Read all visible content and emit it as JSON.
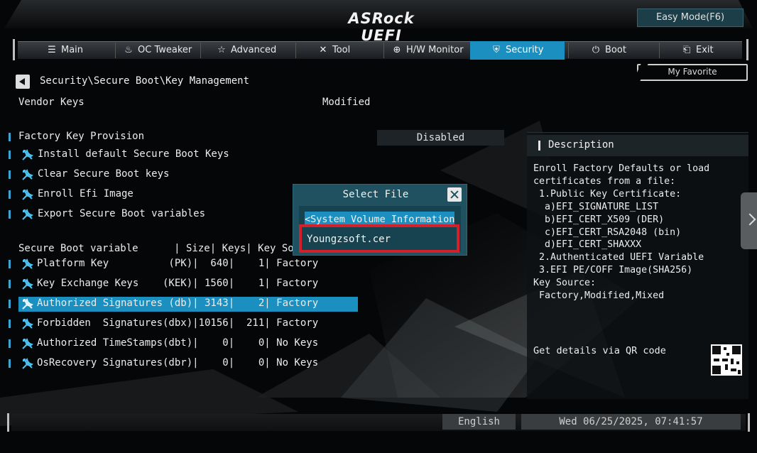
{
  "header": {
    "logo": "ASRock UEFI",
    "easy_mode": "Easy Mode(F6)",
    "my_favorite": "My Favorite"
  },
  "nav": {
    "tabs": [
      {
        "label": "Main",
        "icon": "list-icon"
      },
      {
        "label": "OC Tweaker",
        "icon": "flame-icon"
      },
      {
        "label": "Advanced",
        "icon": "star-icon"
      },
      {
        "label": "Tool",
        "icon": "tools-icon"
      },
      {
        "label": "H/W Monitor",
        "icon": "monitor-icon"
      },
      {
        "label": "Security",
        "icon": "shield-icon"
      },
      {
        "label": "Boot",
        "icon": "power-icon"
      },
      {
        "label": "Exit",
        "icon": "exit-icon"
      }
    ],
    "active": "Security"
  },
  "breadcrumb": "Security\\Secure Boot\\Key Management",
  "vendor_keys": {
    "label": "Vendor Keys",
    "value": "Modified"
  },
  "factory_key_provision": {
    "label": "Factory Key Provision",
    "value": "Disabled"
  },
  "actions": [
    "Install default Secure Boot Keys",
    "Clear Secure Boot keys",
    "Enroll Efi Image",
    "Export Secure Boot variables"
  ],
  "table": {
    "header": "Secure Boot variable      | Size| Keys| Key Source",
    "rows": [
      {
        "text": "Platform Key          (PK)|  640|    1| Factory"
      },
      {
        "text": "Key Exchange Keys    (KEK)| 1560|    1| Factory"
      },
      {
        "text": "Authorized Signatures (db)| 3143|    2| Factory"
      },
      {
        "text": "Forbidden  Signatures(dbx)|10156|  211| Factory"
      },
      {
        "text": "Authorized TimeStamps(dbt)|    0|    0| No Keys"
      },
      {
        "text": "OsRecovery Signatures(dbr)|    0|    0| No Keys"
      }
    ],
    "selected_index": 2
  },
  "description": {
    "title": "Description",
    "body": "Enroll Factory Defaults or load\ncertificates from a file:\n 1.Public Key Certificate:\n  a)EFI_SIGNATURE_LIST\n  b)EFI_CERT_X509 (DER)\n  c)EFI_CERT_RSA2048 (bin)\n  d)EFI_CERT_SHAXXX\n 2.Authenticated UEFI Variable\n 3.EFI PE/COFF Image(SHA256)\nKey Source:\n Factory,Modified,Mixed",
    "qr_label": "Get details via QR code"
  },
  "dialog": {
    "title": "Select File",
    "items": [
      "<System Volume Information>",
      "Youngzsoft.cer"
    ]
  },
  "status": {
    "language": "English",
    "datetime": "Wed 06/25/2025, 07:41:57"
  },
  "colors": {
    "accent": "#1b8fc0",
    "dialog_bg": "#1f5160",
    "highlight_frame": "#d4202a"
  }
}
